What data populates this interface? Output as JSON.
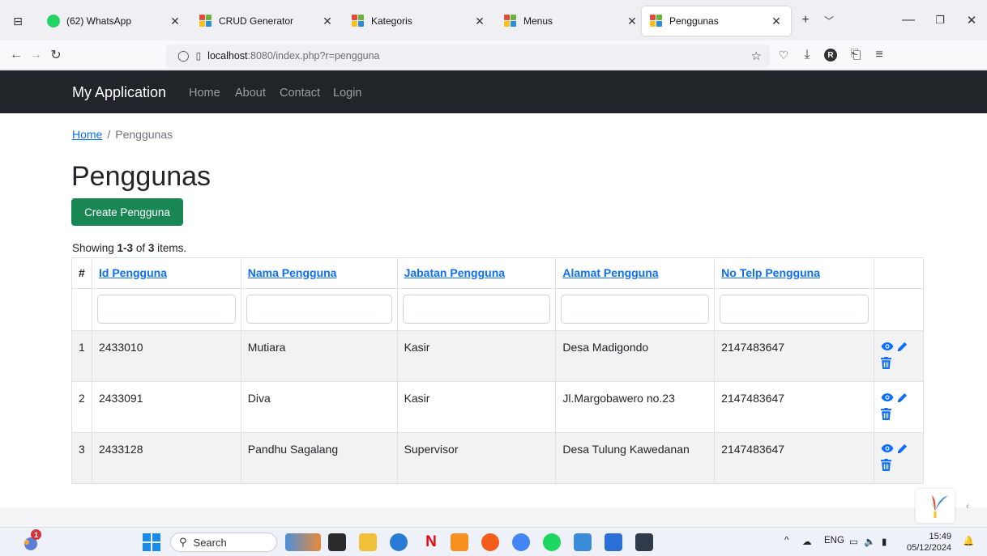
{
  "browser": {
    "tabs": [
      {
        "title": "(62) WhatsApp",
        "favicon": "whatsapp-icon",
        "active": false
      },
      {
        "title": "CRUD Generator",
        "favicon": "yii-icon",
        "active": false
      },
      {
        "title": "Kategoris",
        "favicon": "yii-icon",
        "active": false
      },
      {
        "title": "Menus",
        "favicon": "yii-icon",
        "active": false
      },
      {
        "title": "Penggunas",
        "favicon": "yii-icon",
        "active": true
      }
    ],
    "url_host": "localhost",
    "url_rest": ":8080/index.php?r=pengguna",
    "profile_initial": "R"
  },
  "app": {
    "brand": "My Application",
    "nav": [
      "Home",
      "About",
      "Contact",
      "Login"
    ]
  },
  "breadcrumb": {
    "home": "Home",
    "sep": "/",
    "current": "Penggunas"
  },
  "page": {
    "title": "Penggunas",
    "create_button": "Create Pengguna",
    "summary": {
      "prefix": "Showing ",
      "range": "1-3",
      "middle": " of ",
      "total": "3",
      "suffix": " items."
    }
  },
  "table": {
    "columns": [
      "#",
      "Id Pengguna",
      "Nama Pengguna",
      "Jabatan Pengguna",
      "Alamat Pengguna",
      "No Telp Pengguna"
    ],
    "rows": [
      {
        "n": "1",
        "id": "2433010",
        "nama": "Mutiara",
        "jabatan": "Kasir",
        "alamat": "Desa Madigondo",
        "telp": "2147483647"
      },
      {
        "n": "2",
        "id": "2433091",
        "nama": "Diva",
        "jabatan": "Kasir",
        "alamat": "Jl.Margobawero no.23",
        "telp": "2147483647"
      },
      {
        "n": "3",
        "id": "2433128",
        "nama": "Pandhu Sagalang",
        "jabatan": "Supervisor",
        "alamat": "Desa Tulung Kawedanan",
        "telp": "2147483647"
      }
    ],
    "actions": [
      "view-icon",
      "update-icon",
      "delete-icon"
    ]
  },
  "taskbar": {
    "search_label": "Search",
    "notification_count": "1",
    "language": "ENG",
    "time": "15:49",
    "date": "05/12/2024"
  },
  "colors": {
    "primary": "#0d6efd",
    "success": "#198754",
    "navbar": "#212529",
    "yii_red": "#e04e39",
    "yii_green": "#6bb23c",
    "yii_blue": "#2f8dd8",
    "yii_yellow": "#f7c21b"
  }
}
